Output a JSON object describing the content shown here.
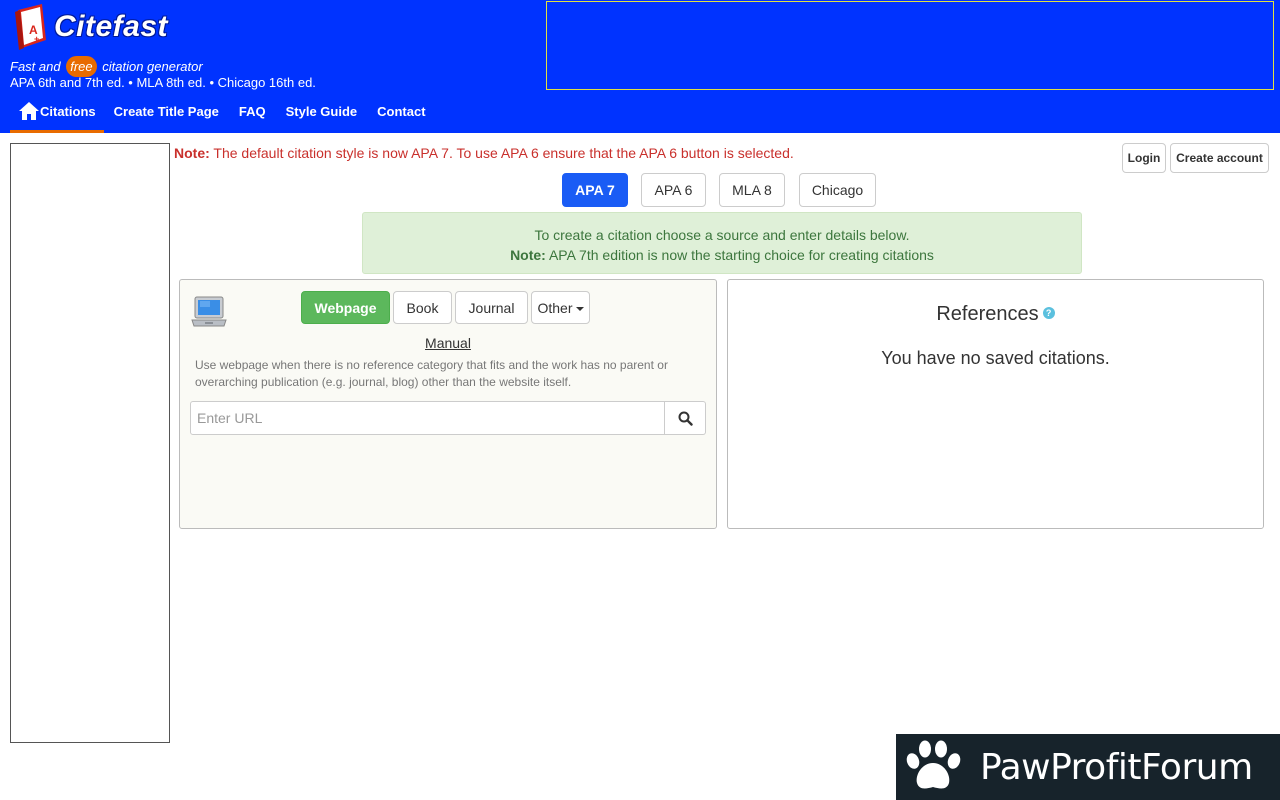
{
  "header": {
    "brand": "Citefast",
    "tagline_before": "Fast and",
    "tagline_badge": "free",
    "tagline_after": "citation generator",
    "editions": "APA 6th and 7th ed. • MLA 8th ed. • Chicago 16th ed.",
    "colors": {
      "background": "#0033ff",
      "accent": "#e86b00"
    }
  },
  "nav": {
    "items": [
      {
        "label": "Citations",
        "icon": "home-icon",
        "active": true
      },
      {
        "label": "Create Title Page"
      },
      {
        "label": "FAQ"
      },
      {
        "label": "Style Guide"
      },
      {
        "label": "Contact"
      }
    ]
  },
  "notice": {
    "prefix": "Note:",
    "text": " The default citation style is now APA 7. To use APA 6 ensure that the APA 6 button is selected."
  },
  "auth": {
    "login": "Login",
    "create_account": "Create account"
  },
  "styles": {
    "selected": "APA 7",
    "options": [
      "APA 7",
      "APA 6",
      "MLA 8",
      "Chicago"
    ]
  },
  "info": {
    "line1": "To create a citation choose a source and enter details below.",
    "note_prefix": "Note:",
    "note_text": " APA 7th edition is now the starting choice for creating citations"
  },
  "source": {
    "icon": "laptop-icon",
    "selected": "Webpage",
    "options": [
      "Webpage",
      "Book",
      "Journal",
      "Other"
    ],
    "manual_link": "Manual",
    "help": "Use webpage when there is no reference category that fits and the work has no parent or overarching publication (e.g. journal, blog) other than the website itself.",
    "url_placeholder": "Enter URL",
    "url_value": ""
  },
  "references": {
    "title": "References",
    "help_icon": "question-icon",
    "empty_message": "You have no saved citations."
  },
  "watermark": {
    "text": "PawProfitForum",
    "icon": "paw-icon"
  }
}
